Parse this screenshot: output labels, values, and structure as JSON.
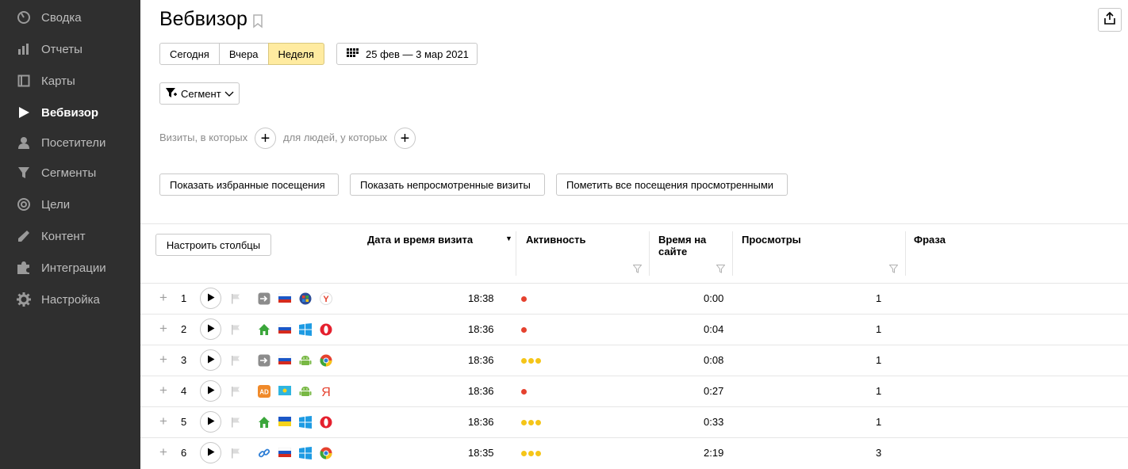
{
  "sidebar": {
    "items": [
      {
        "label": "Сводка",
        "icon": "dashboard-icon"
      },
      {
        "label": "Отчеты",
        "icon": "bar-chart-icon"
      },
      {
        "label": "Карты",
        "icon": "map-icon"
      },
      {
        "label": "Вебвизор",
        "icon": "play-icon",
        "active": true
      },
      {
        "label": "Посетители",
        "icon": "user-icon"
      },
      {
        "label": "Сегменты",
        "icon": "filter-icon"
      },
      {
        "label": "Цели",
        "icon": "target-icon"
      },
      {
        "label": "Контент",
        "icon": "pencil-icon"
      },
      {
        "label": "Интеграции",
        "icon": "puzzle-icon"
      },
      {
        "label": "Настройка",
        "icon": "gear-icon"
      }
    ]
  },
  "header": {
    "title": "Вебвизор"
  },
  "period": {
    "buttons": [
      "Сегодня",
      "Вчера",
      "Неделя"
    ],
    "selected": "Неделя",
    "date_range": "25 фев — 3 мар 2021"
  },
  "segment": {
    "label": "Сегмент"
  },
  "conditions": {
    "visits_label": "Визиты, в которых",
    "people_label": "для людей, у которых"
  },
  "actions": {
    "favorites": "Показать избранные посещения",
    "unviewed": "Показать непросмотренные визиты",
    "mark_all": "Пометить все посещения просмотренными"
  },
  "table": {
    "configure_label": "Настроить столбцы",
    "columns": {
      "datetime": "Дата и время визита",
      "activity": "Активность",
      "duration_line1": "Время на",
      "duration_line2": "сайте",
      "views": "Просмотры",
      "phrase": "Фраза"
    },
    "rows": [
      {
        "num": "1",
        "source": "direct-icon",
        "country": "flag-ru",
        "os": "windows-7-icon",
        "browser": "yandex-browser-icon",
        "time": "18:38",
        "activity": 1,
        "activity_color": "#e5412e",
        "duration": "0:00",
        "views": "1"
      },
      {
        "num": "2",
        "source": "home-icon",
        "country": "flag-ru",
        "os": "windows-icon",
        "browser": "opera-icon",
        "time": "18:36",
        "activity": 1,
        "activity_color": "#e5412e",
        "duration": "0:04",
        "views": "1"
      },
      {
        "num": "3",
        "source": "direct-icon",
        "country": "flag-ru",
        "os": "android-icon",
        "browser": "chrome-icon",
        "time": "18:36",
        "activity": 3,
        "activity_color": "#f5c518",
        "duration": "0:08",
        "views": "1"
      },
      {
        "num": "4",
        "source": "ad-icon",
        "country": "flag-kz",
        "os": "android-icon",
        "browser": "yandex-icon",
        "time": "18:36",
        "activity": 1,
        "activity_color": "#e5412e",
        "duration": "0:27",
        "views": "1"
      },
      {
        "num": "5",
        "source": "home-icon",
        "country": "flag-ua",
        "os": "windows-icon",
        "browser": "opera-icon",
        "time": "18:36",
        "activity": 3,
        "activity_color": "#f5c518",
        "duration": "0:33",
        "views": "1"
      },
      {
        "num": "6",
        "source": "link-icon",
        "country": "flag-ru",
        "os": "windows-icon",
        "browser": "chrome-icon",
        "time": "18:35",
        "activity": 3,
        "activity_color": "#f5c518",
        "duration": "2:19",
        "views": "3"
      }
    ]
  }
}
